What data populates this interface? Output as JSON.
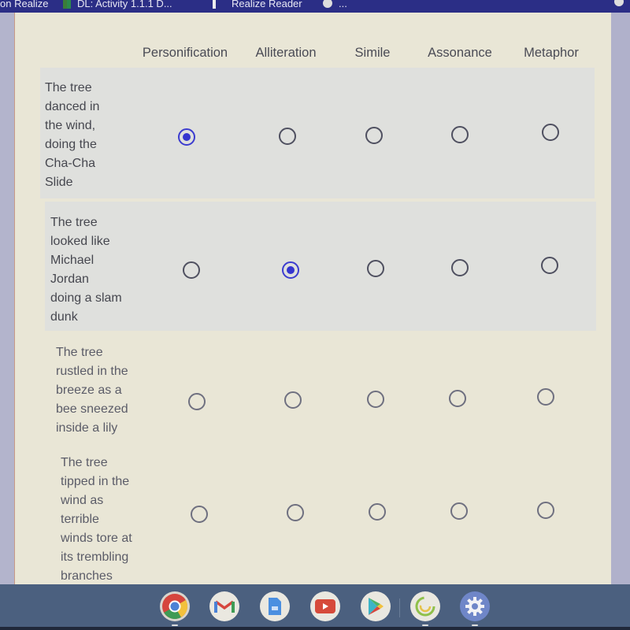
{
  "bookmarks_bar": {
    "items": [
      {
        "label": "on Realize",
        "icon": "bookmark-icon"
      },
      {
        "label": "DL: Activity 1.1.1 D...",
        "icon": "google-sheets-icon"
      },
      {
        "label": "Realize Reader",
        "icon": "bookmark-icon"
      },
      {
        "label": "...",
        "icon": "globe-icon"
      }
    ]
  },
  "form": {
    "columns": [
      "Personification",
      "Alliteration",
      "Simile",
      "Assonance",
      "Metaphor"
    ],
    "rows": [
      {
        "label": "The tree danced in the wind, doing the Cha-Cha Slide",
        "lines": [
          "The tree",
          "danced in",
          "the wind,",
          "doing the",
          "Cha-Cha",
          "Slide"
        ],
        "selected": "Personification"
      },
      {
        "label": "The tree looked like Michael Jordan doing a slam dunk",
        "lines": [
          "The tree",
          "looked like",
          "Michael",
          "Jordan",
          "doing a slam",
          "dunk"
        ],
        "selected": "Alliteration"
      },
      {
        "label": "The tree rustled in the breeze as a bee sneezed inside a lily",
        "lines": [
          "The tree",
          "rustled in the",
          "breeze as a",
          "bee sneezed",
          "inside a lily"
        ],
        "selected": null
      },
      {
        "label": "The tree tipped in the wind as terrible winds tore at its trembling branches",
        "lines": [
          "The tree",
          "tipped in the",
          "wind as",
          "terrible",
          "winds tore at",
          "its trembling",
          "branches"
        ],
        "selected": null
      }
    ],
    "colors": {
      "selected_radio": "#3535cf",
      "unselected_radio": "#4f5060",
      "card_background": "#e9e6d6",
      "shaded_row": "#dfe0dd"
    }
  },
  "shelf": {
    "apps": [
      {
        "name": "Chrome",
        "icon": "chrome-icon",
        "running": true
      },
      {
        "name": "Gmail",
        "icon": "gmail-icon",
        "running": false
      },
      {
        "name": "Google Docs",
        "icon": "google-docs-icon",
        "running": false
      },
      {
        "name": "YouTube",
        "icon": "youtube-icon",
        "running": false
      },
      {
        "name": "Play Store",
        "icon": "play-store-icon",
        "running": false
      },
      {
        "name": "App",
        "icon": "loading-circle-icon",
        "running": true
      },
      {
        "name": "Settings",
        "icon": "settings-gear-icon",
        "running": true
      }
    ]
  }
}
